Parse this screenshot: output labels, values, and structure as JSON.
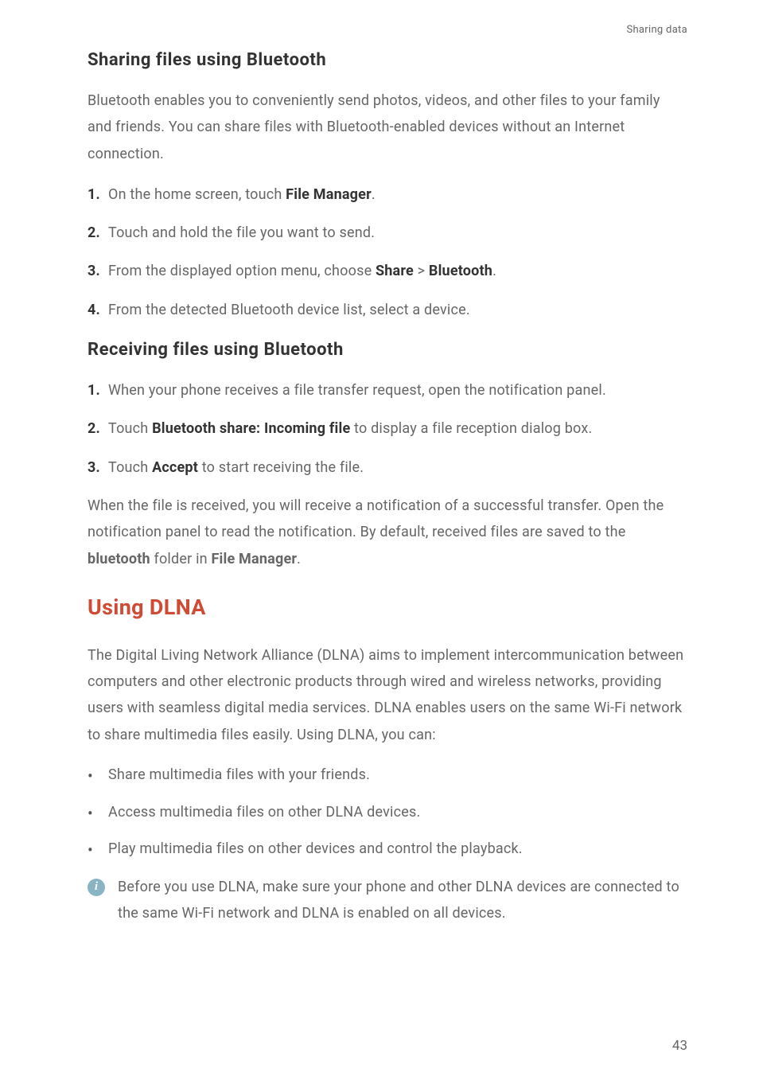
{
  "header": {
    "breadcrumb": "Sharing data"
  },
  "section1": {
    "title": "Sharing files using Bluetooth",
    "intro": "Bluetooth enables you to conveniently send photos, videos, and other files to your family and friends. You can share files with Bluetooth-enabled devices without an Internet connection.",
    "steps": {
      "s1": {
        "num": "1.",
        "pre": "On the home screen, touch ",
        "b1": "File Manager",
        "post": "."
      },
      "s2": {
        "num": "2.",
        "text": "Touch and hold the file you want to send."
      },
      "s3": {
        "num": "3.",
        "pre": "From the displayed option menu, choose ",
        "b1": "Share",
        "mid": " > ",
        "b2": "Bluetooth",
        "post": "."
      },
      "s4": {
        "num": "4.",
        "text": "From the detected Bluetooth device list, select a device."
      }
    }
  },
  "section2": {
    "title": "Receiving files using Bluetooth",
    "steps": {
      "s1": {
        "num": "1.",
        "text": "When your phone receives a file transfer request, open the notification panel."
      },
      "s2": {
        "num": "2.",
        "pre": "Touch ",
        "b1": "Bluetooth share: Incoming file",
        "post": " to display a file reception dialog box."
      },
      "s3": {
        "num": "3.",
        "pre": "Touch ",
        "b1": "Accept",
        "post": " to start receiving the file."
      }
    },
    "outro_pre": "When the file is received, you will receive a notification of a successful transfer. Open the notification panel to read the notification. By default, received files are saved to the ",
    "outro_b1": "bluetooth",
    "outro_mid": " folder in ",
    "outro_b2": "File Manager",
    "outro_post": "."
  },
  "section3": {
    "title": "Using DLNA",
    "intro": "The Digital Living Network Alliance (DLNA) aims to implement intercommunication between computers and other electronic products through wired and wireless networks, providing users with seamless digital media services. DLNA enables users on the same Wi-Fi network to share multimedia files easily. Using DLNA, you can:",
    "bullets": {
      "b1": "Share multimedia files with your friends.",
      "b2": "Access multimedia files on other DLNA devices.",
      "b3": "Play multimedia files on other devices and control the playback."
    },
    "info": "Before you use DLNA, make sure your phone and other DLNA devices are connected to the same Wi-Fi network and DLNA is enabled on all devices."
  },
  "pageNumber": "43",
  "icons": {
    "info_glyph": "i",
    "bullet_glyph": "•"
  }
}
